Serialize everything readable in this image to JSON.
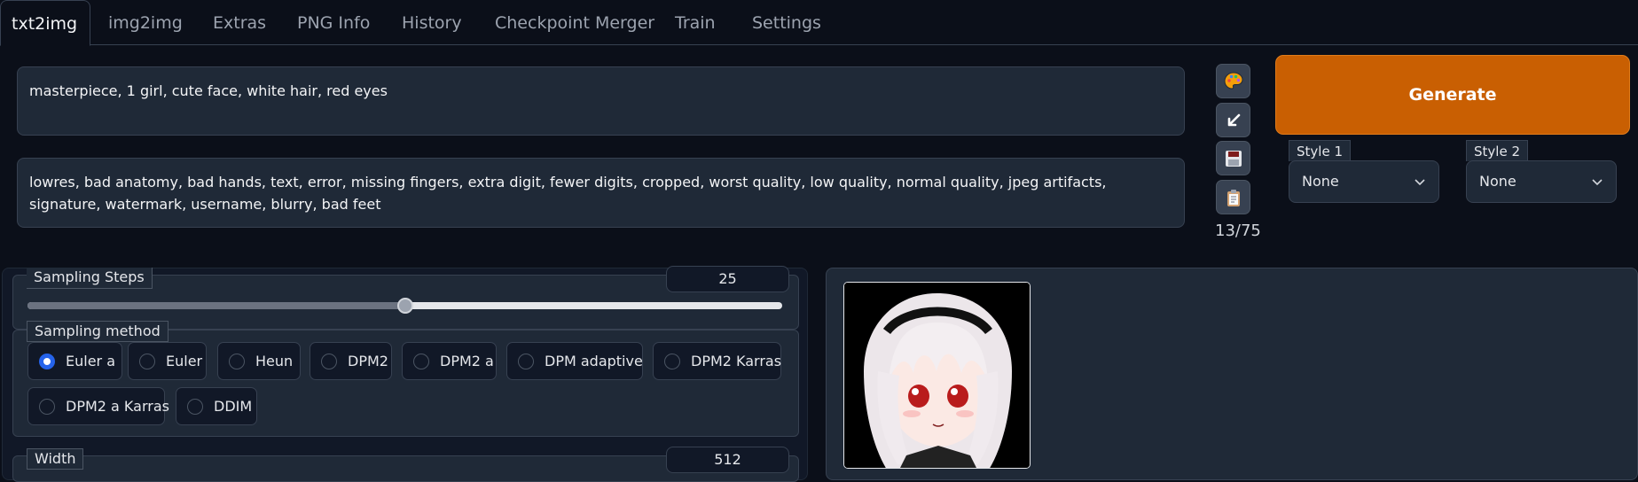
{
  "tabs": [
    "txt2img",
    "img2img",
    "Extras",
    "PNG Info",
    "History",
    "Checkpoint Merger",
    "Train",
    "Settings"
  ],
  "prompt": {
    "positive": "masterpiece, 1 girl, cute face, white hair, red eyes",
    "negative": "lowres, bad anatomy, bad hands, text, error, missing fingers, extra digit, fewer digits, cropped, worst quality, low quality, normal quality, jpeg artifacts, signature, watermark, username, blurry, bad feet",
    "token_count": "13/75"
  },
  "tools": [
    "palette-icon",
    "arrow-icon",
    "save-icon",
    "clipboard-icon"
  ],
  "generate_label": "Generate",
  "styles": [
    {
      "label": "Style 1",
      "value": "None"
    },
    {
      "label": "Style 2",
      "value": "None"
    }
  ],
  "sampling_steps": {
    "label": "Sampling Steps",
    "value": "25",
    "level": 0.5
  },
  "sampling_method": {
    "label": "Sampling method",
    "options": [
      "Euler a",
      "Euler",
      "Heun",
      "DPM2",
      "DPM2 a",
      "DPM adaptive",
      "DPM2 Karras",
      "DPM2 a Karras",
      "DDIM"
    ],
    "selected": "Euler a"
  },
  "width": {
    "label": "Width",
    "value": "512"
  },
  "colors": {
    "accent": "#c95f02",
    "background": "#0b0f19",
    "panel": "#1f2937",
    "radio_checked": "#2563eb"
  }
}
